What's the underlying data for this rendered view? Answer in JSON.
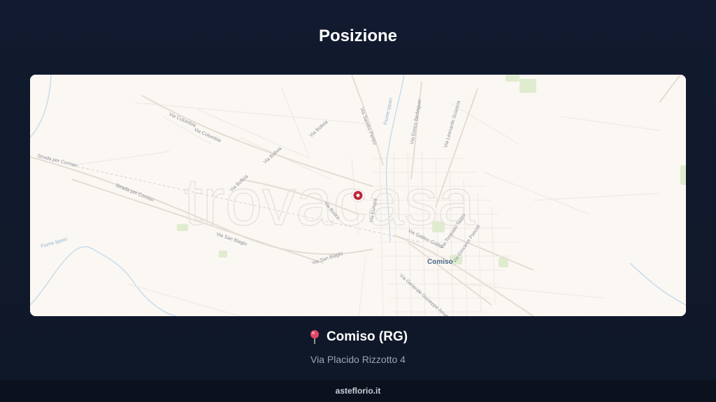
{
  "page": {
    "title": "Posizione"
  },
  "map": {
    "watermark": "trovacasa",
    "city_label": "Comiso",
    "streets": [
      "Via Colombia",
      "Via Colombia",
      "Via Bolivia",
      "Via Bolivia",
      "Via Bolivia",
      "Strada per Comiso",
      "Strada per Comiso",
      "Via San Biagio",
      "Via San Biagio",
      "Via Sandro Pertini",
      "Via Enrico Berlinguer",
      "Via Leonardo Sciascia",
      "Via Galileo Galilei",
      "Via Torquato Tasso",
      "Via Giovanni Pascoli",
      "Via Generale Giuseppe Amato",
      "Via Bosco",
      "Via Europa",
      "Fiume Ippari",
      "Fiume Ippari"
    ],
    "marker": {
      "type": "location-marker",
      "color": "#c0283a"
    }
  },
  "location": {
    "icon": "pin-icon",
    "title": "Comiso (RG)",
    "address": "Via Placido Rizzotto 4"
  },
  "footer": {
    "site": "asteflorio.it"
  }
}
